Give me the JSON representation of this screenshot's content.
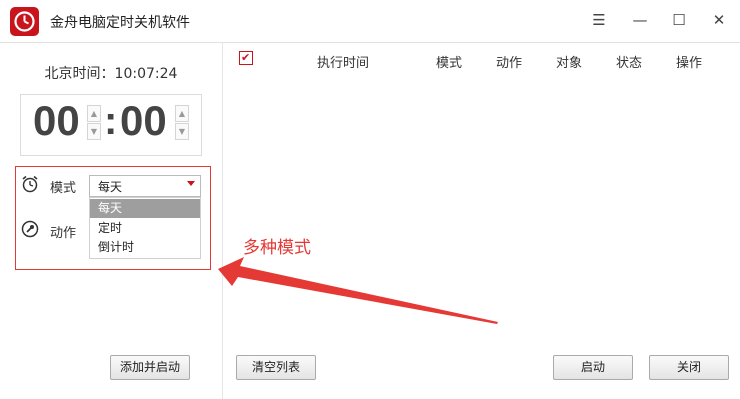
{
  "window": {
    "title": "金舟电脑定时关机软件",
    "menu_icon": "☰",
    "minimize_icon": "—",
    "maximize_icon": "☐",
    "close_icon": "✕",
    "brand_color": "#c8141c"
  },
  "left": {
    "clock_label": "北京时间：10:07:24",
    "hours": "00",
    "minutes": "00",
    "colon": ":",
    "mode_label": "模式",
    "action_label": "动作",
    "mode_value": "每天",
    "mode_options": [
      "每天",
      "定时",
      "倒计时"
    ],
    "add_start_button": "添加并启动"
  },
  "table": {
    "columns": [
      "执行时间",
      "模式",
      "动作",
      "对象",
      "状态",
      "操作"
    ],
    "clear_button": "清空列表",
    "start_button": "启动",
    "close_button": "关闭"
  },
  "annotation": {
    "text": "多种模式",
    "color": "#e53935"
  }
}
